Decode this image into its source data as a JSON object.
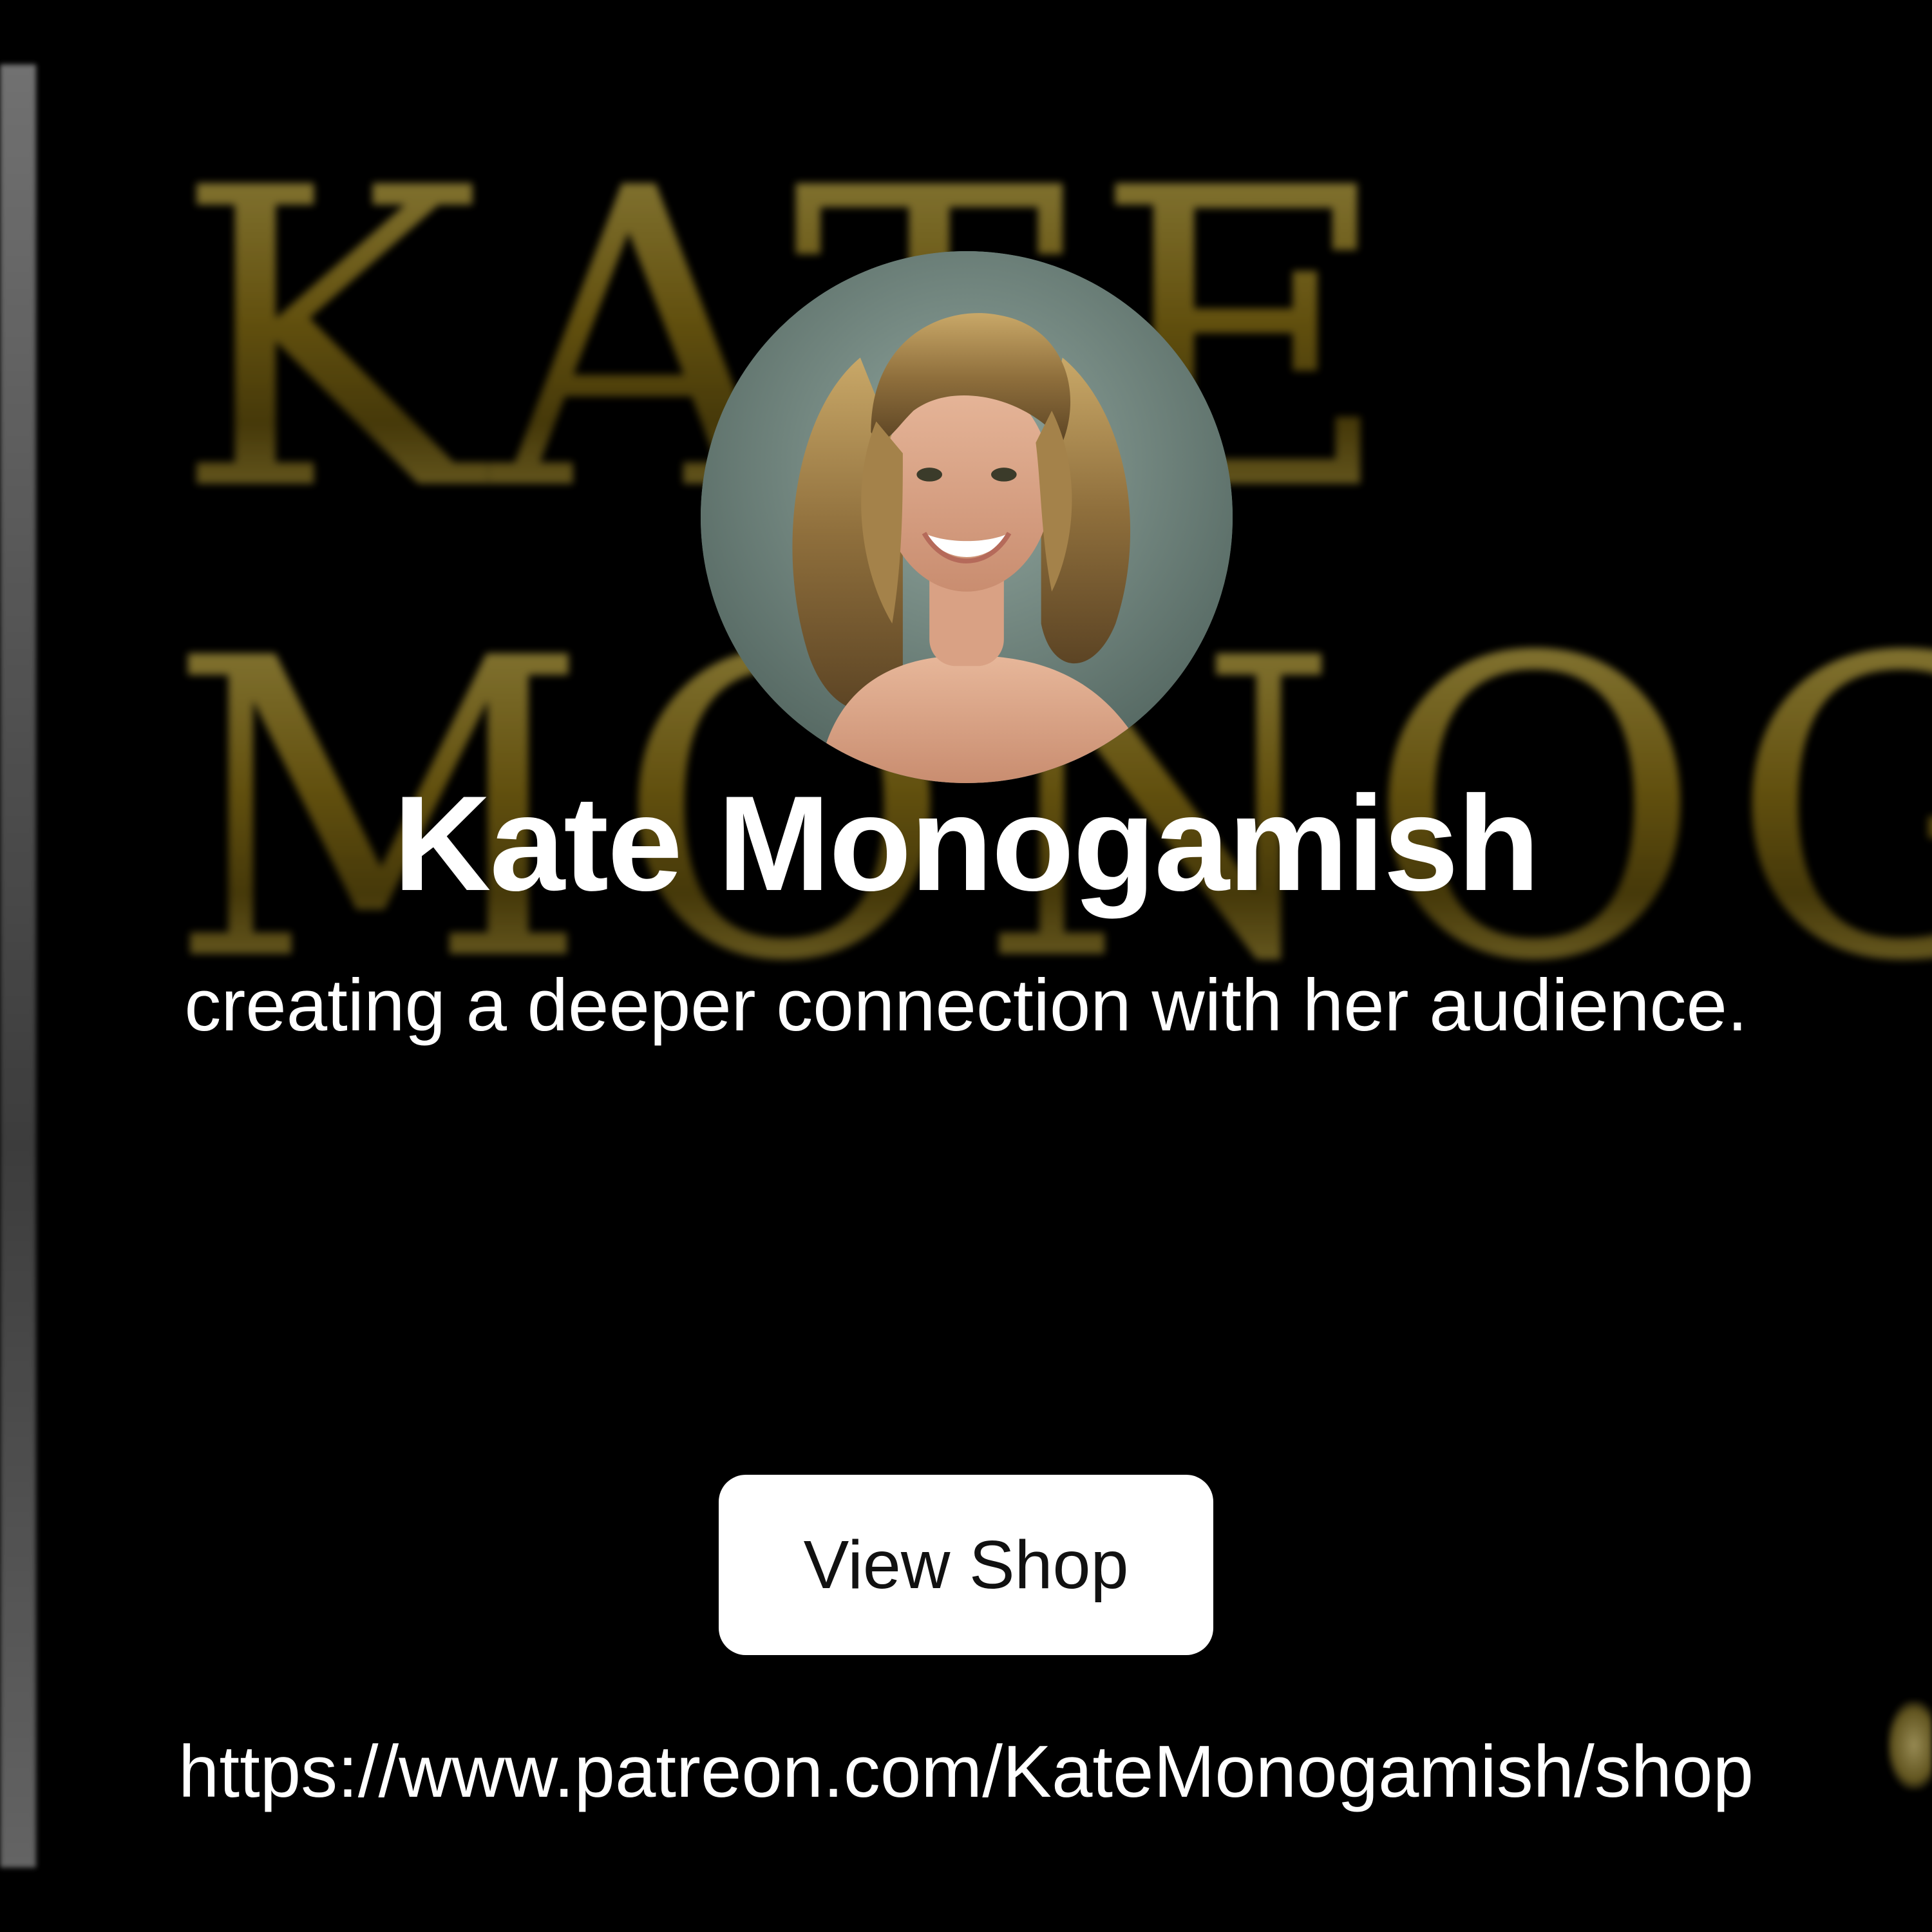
{
  "background": {
    "artwork_lines": [
      "KATE",
      "MONOG"
    ],
    "base_color": "#000000",
    "lettering_color": "#b59a2c"
  },
  "profile": {
    "avatar_alt": "avatar",
    "name": "Kate Monogamish",
    "tagline": "creating a deeper connection with her audience."
  },
  "actions": {
    "view_shop_label": "View Shop"
  },
  "link": {
    "url": "https://www.patreon.com/KateMonogamish/shop"
  },
  "colors": {
    "text": "#ffffff",
    "button_bg": "#ffffff",
    "button_text": "#111111"
  }
}
